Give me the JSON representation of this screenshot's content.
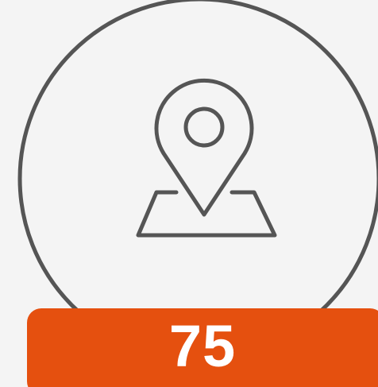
{
  "tile": {
    "icon": "map-pin-icon",
    "badge_value": "75"
  },
  "colors": {
    "background": "#f4f4f4",
    "outline": "#555555",
    "badge": "#e5500f",
    "badge_text": "#ffffff"
  }
}
